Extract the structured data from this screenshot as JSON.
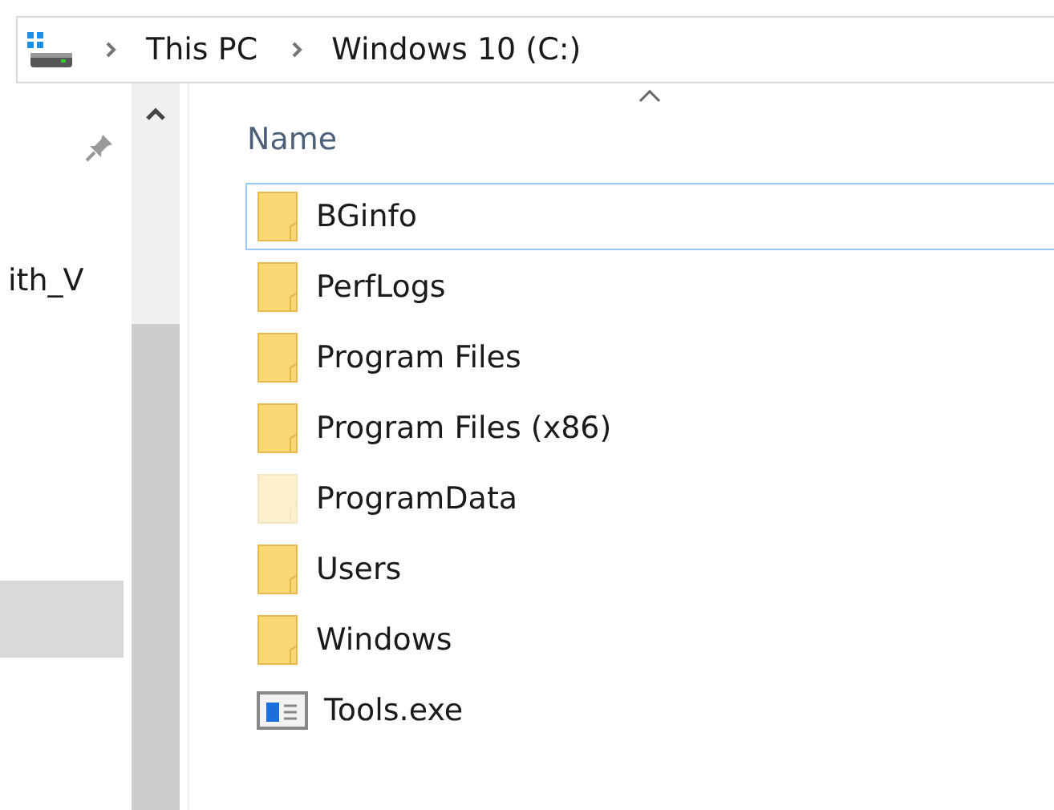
{
  "address_bar": {
    "crumbs": [
      "This PC",
      "Windows 10 (C:)"
    ]
  },
  "navigation_pane": {
    "items": [
      {
        "label": "ith_V",
        "selected": false
      },
      {
        "selected": true
      }
    ]
  },
  "file_list": {
    "columns": [
      {
        "label": "Name",
        "sorted": true
      }
    ],
    "items": [
      {
        "name": "BGinfo",
        "kind": "folder",
        "hidden": false,
        "focused": true
      },
      {
        "name": "PerfLogs",
        "kind": "folder",
        "hidden": false,
        "focused": false
      },
      {
        "name": "Program Files",
        "kind": "folder",
        "hidden": false,
        "focused": false
      },
      {
        "name": "Program Files (x86)",
        "kind": "folder",
        "hidden": false,
        "focused": false
      },
      {
        "name": "ProgramData",
        "kind": "folder",
        "hidden": true,
        "focused": false
      },
      {
        "name": "Users",
        "kind": "folder",
        "hidden": false,
        "focused": false
      },
      {
        "name": "Windows",
        "kind": "folder",
        "hidden": false,
        "focused": false
      },
      {
        "name": "Tools.exe",
        "kind": "exe",
        "hidden": false,
        "focused": false
      }
    ]
  }
}
